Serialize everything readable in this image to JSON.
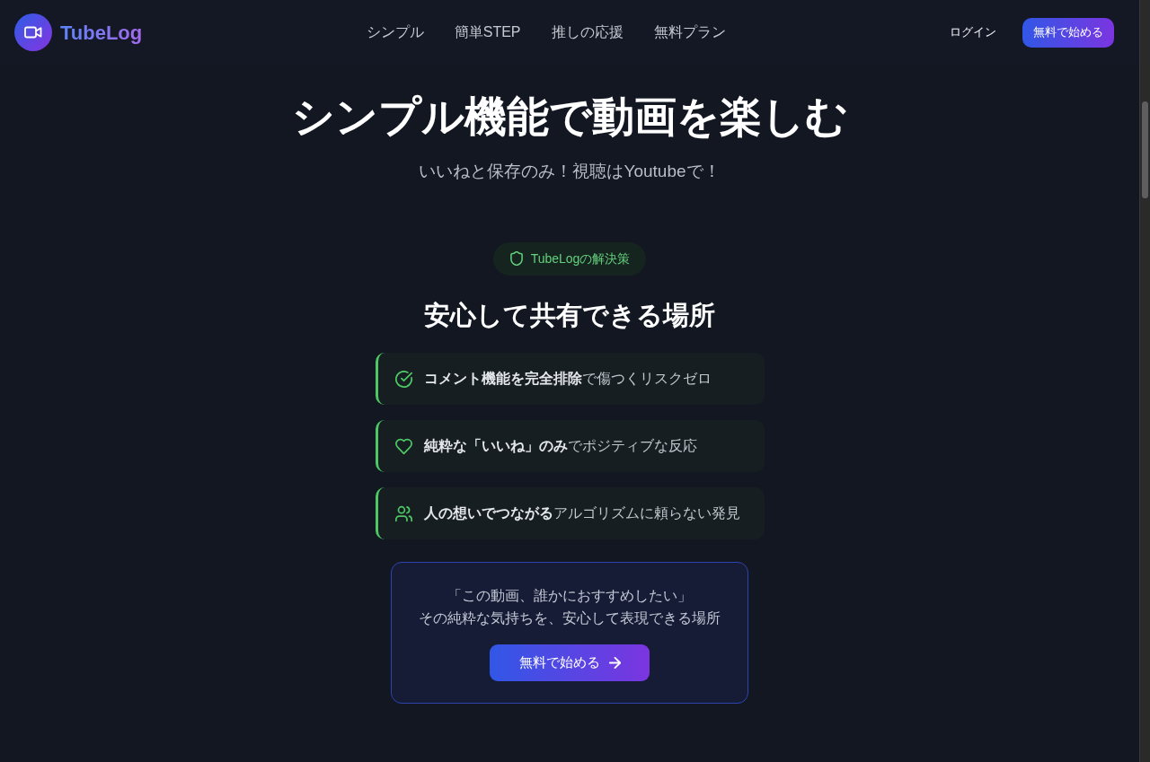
{
  "nav": {
    "brand": "TubeLog",
    "links": [
      "シンプル",
      "簡単STEP",
      "推しの応援",
      "無料プラン"
    ],
    "login": "ログイン",
    "cta": "無料で始める"
  },
  "hero": {
    "title": "シンプル機能で動画を楽しむ",
    "subtitle": "いいねと保存のみ！視聴はYoutubeで！"
  },
  "solution": {
    "badge": "TubeLogの解決策",
    "heading": "安心して共有できる場所",
    "features": [
      {
        "kind": "check",
        "text": "**コメント機能を完全排除**で傷つくリスクゼロ"
      },
      {
        "kind": "heart",
        "text": "**純粋な「いいね」のみ**でポジティブな反応"
      },
      {
        "kind": "users",
        "text": "**人の想いでつながる**アルゴリズムに頼らない発見"
      }
    ]
  },
  "cta_box": {
    "lines": [
      "「この動画、誰かにおすすめしたい」",
      "その純粋な気持ちを、安心して表現できる場所"
    ],
    "button": "無料で始める"
  }
}
